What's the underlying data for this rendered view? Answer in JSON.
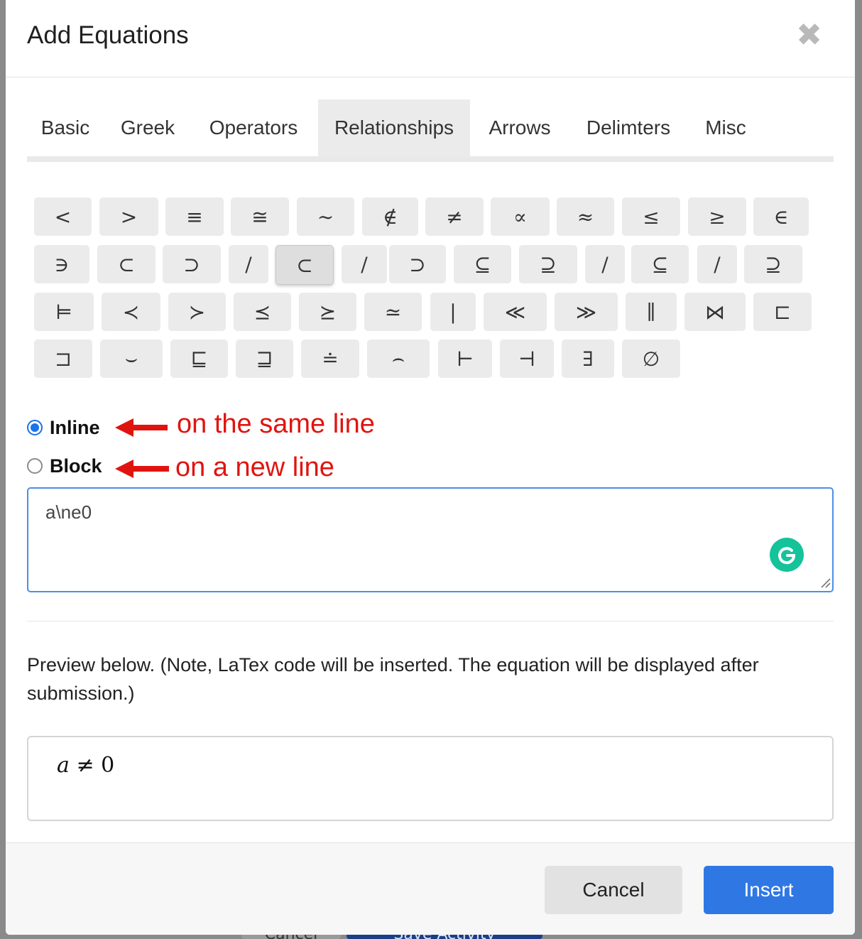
{
  "modal": {
    "title": "Add Equations",
    "close_glyph": "✖"
  },
  "tabs": [
    {
      "label": "Basic"
    },
    {
      "label": "Greek"
    },
    {
      "label": "Operators"
    },
    {
      "label": "Relationships",
      "active": true
    },
    {
      "label": "Arrows"
    },
    {
      "label": "Delimters"
    },
    {
      "label": "Misc"
    }
  ],
  "symbols": {
    "row1": [
      "<",
      ">",
      "≡",
      "≅",
      "∼",
      "∉",
      "≠",
      "∝",
      "≈",
      "≤",
      "≥",
      "∈"
    ],
    "row2": [
      "∋",
      "⊂",
      "⊃",
      "/",
      "⊂",
      "/",
      "⊃",
      "⊆",
      "⊇",
      "/",
      "⊆",
      "/",
      "⊇"
    ],
    "row3": [
      "⊨",
      "≺",
      "≻",
      "⪯",
      "⪰",
      "≃",
      "|",
      "≪",
      "≫",
      "∥",
      "⋈",
      "⊏"
    ],
    "row4": [
      "⊐",
      "⌣",
      "⊑",
      "⊒",
      "≐",
      "⌢",
      "⊢",
      "⊣",
      "∃",
      "∅"
    ]
  },
  "mode": {
    "inline_label": "Inline",
    "block_label": "Block",
    "selected": "inline"
  },
  "annotations": {
    "inline_note": "on the same line",
    "block_note": "on a new line",
    "color": "#e0140f"
  },
  "equation": {
    "value": "a\\ne0"
  },
  "preview": {
    "note": "Preview below. (Note, LaTex code will be inserted. The equation will be displayed after submission.)",
    "var": "a",
    "rel": "≠",
    "num": "0"
  },
  "footer": {
    "cancel_label": "Cancel",
    "insert_label": "Insert"
  },
  "background": {
    "cancel_label": "Cancel",
    "save_label": "Save Activity"
  },
  "colors": {
    "primary": "#2f78e4",
    "grammarly": "#15c39a"
  }
}
